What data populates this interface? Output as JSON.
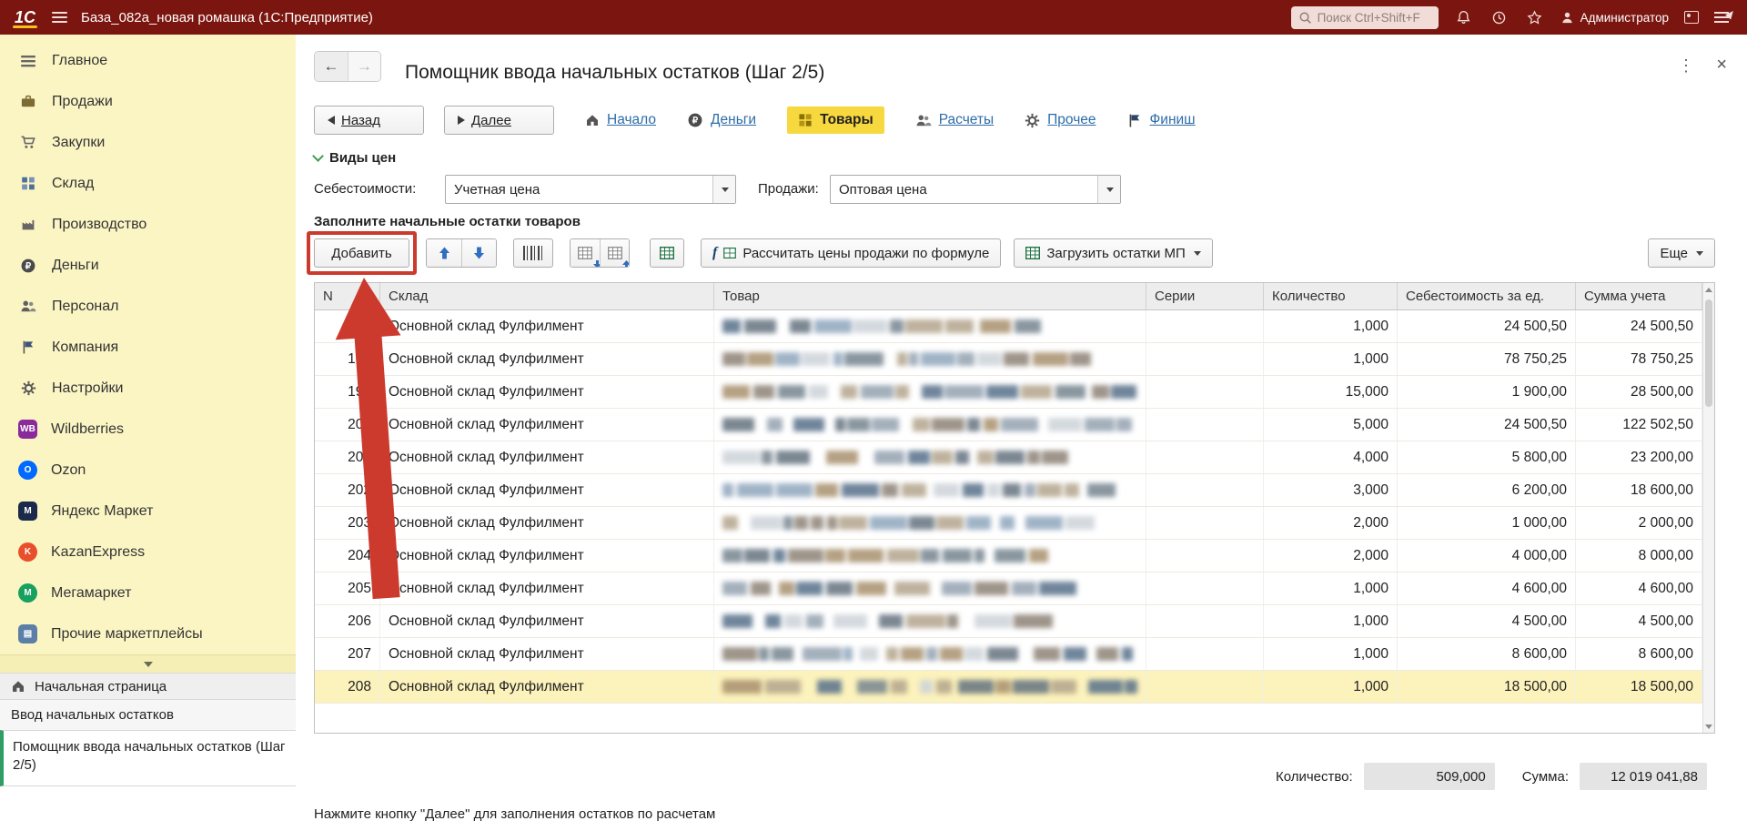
{
  "topbar": {
    "logo": "1С",
    "title": "База_082а_новая ромашка (1С:Предприятие)",
    "search_placeholder": "Поиск Ctrl+Shift+F",
    "user": "Администратор"
  },
  "colors": {
    "topbar_red": "#7B150F",
    "sidebar_yellow": "#FBF5C4",
    "active_step_yellow": "#F7D93F",
    "selected_row_yellow": "#FCF2BC",
    "link_blue": "#2D6DA8",
    "annotation_red": "#CC3A2D",
    "active_tab_marker_green": "#2E9E62"
  },
  "sidebar": {
    "items": [
      {
        "id": "main",
        "label": "Главное",
        "icon": "sections-icon"
      },
      {
        "id": "sales",
        "label": "Продажи",
        "icon": "briefcase-icon"
      },
      {
        "id": "purchases",
        "label": "Закупки",
        "icon": "cart-icon"
      },
      {
        "id": "warehouse",
        "label": "Склад",
        "icon": "warehouse-icon"
      },
      {
        "id": "production",
        "label": "Производство",
        "icon": "factory-icon"
      },
      {
        "id": "money",
        "label": "Деньги",
        "icon": "ruble-icon"
      },
      {
        "id": "staff",
        "label": "Персонал",
        "icon": "people-icon"
      },
      {
        "id": "company",
        "label": "Компания",
        "icon": "flag-icon"
      },
      {
        "id": "settings",
        "label": "Настройки",
        "icon": "gear-icon"
      },
      {
        "id": "wildberries",
        "label": "Wildberries",
        "icon": "wildberries-icon",
        "badge": "WB",
        "color": "#8A2A9B"
      },
      {
        "id": "ozon",
        "label": "Ozon",
        "icon": "ozon-icon",
        "badge": "O",
        "color": "#0069FF",
        "round": true
      },
      {
        "id": "yandex-market",
        "label": "Яндекс Маркет",
        "icon": "yandex-market-icon",
        "badge": "М",
        "color": "#1B2A4A"
      },
      {
        "id": "kazanexpress",
        "label": "KazanExpress",
        "icon": "kazanexpress-icon",
        "badge": "K",
        "color": "#E8502B",
        "round": true
      },
      {
        "id": "megamarket",
        "label": "Мегамаркет",
        "icon": "megamarket-icon",
        "badge": "М",
        "color": "#18A05E",
        "round": true
      },
      {
        "id": "other-marketplaces",
        "label": "Прочие маркетплейсы",
        "icon": "storefront-icon",
        "badge": "▤",
        "color": "#5B7FA6"
      }
    ],
    "footer_tabs": [
      "Начальная страница",
      "Ввод начальных остатков",
      "Помощник ввода начальных остатков (Шаг 2/5)"
    ]
  },
  "wizard": {
    "title": "Помощник ввода начальных остатков (Шаг 2/5)",
    "back": "Назад",
    "next": "Далее",
    "steps": [
      {
        "id": "nachalo",
        "label": "Начало",
        "icon": "home-icon",
        "active": false
      },
      {
        "id": "dengi",
        "label": "Деньги",
        "icon": "ruble-icon",
        "active": false
      },
      {
        "id": "tovary",
        "label": "Товары",
        "icon": "goods-icon",
        "active": true
      },
      {
        "id": "raschety",
        "label": "Расчеты",
        "icon": "people-icon",
        "active": false
      },
      {
        "id": "prochee",
        "label": "Прочее",
        "icon": "gear-icon",
        "active": false
      },
      {
        "id": "finish",
        "label": "Финиш",
        "icon": "finish-flag-icon",
        "active": false
      }
    ],
    "price_types": {
      "section_label": "Виды цен",
      "cost_label": "Себестоимости:",
      "cost_value": "Учетная цена",
      "sale_label": "Продажи:",
      "sale_value": "Оптовая цена"
    },
    "fill_caption": "Заполните начальные остатки товаров",
    "toolbar": {
      "add": "Добавить",
      "calc_prices": "Рассчитать цены продажи по формуле",
      "load_mp": "Загрузить остатки МП",
      "more": "Еще"
    },
    "hint": "Нажмите кнопку \"Далее\" для заполнения остатков по расчетам"
  },
  "table": {
    "columns": [
      "N",
      "Склад",
      "Товар",
      "Серии",
      "Количество",
      "Себестоимость за ед.",
      "Сумма учета"
    ],
    "rows": [
      {
        "n": "197",
        "warehouse": "Основной склад Фулфилмент",
        "quantity": "1,000",
        "unit_cost": "24 500,50",
        "total": "24 500,50"
      },
      {
        "n": "198",
        "warehouse": "Основной склад Фулфилмент",
        "quantity": "1,000",
        "unit_cost": "78 750,25",
        "total": "78 750,25"
      },
      {
        "n": "199",
        "warehouse": "Основной склад Фулфилмент",
        "quantity": "15,000",
        "unit_cost": "1 900,00",
        "total": "28 500,00"
      },
      {
        "n": "200",
        "warehouse": "Основной склад Фулфилмент",
        "quantity": "5,000",
        "unit_cost": "24 500,50",
        "total": "122 502,50"
      },
      {
        "n": "201",
        "warehouse": "Основной склад Фулфилмент",
        "quantity": "4,000",
        "unit_cost": "5 800,00",
        "total": "23 200,00"
      },
      {
        "n": "202",
        "warehouse": "Основной склад Фулфилмент",
        "quantity": "3,000",
        "unit_cost": "6 200,00",
        "total": "18 600,00"
      },
      {
        "n": "203",
        "warehouse": "Основной склад Фулфилмент",
        "quantity": "2,000",
        "unit_cost": "1 000,00",
        "total": "2 000,00"
      },
      {
        "n": "204",
        "warehouse": "Основной склад Фулфилмент",
        "quantity": "2,000",
        "unit_cost": "4 000,00",
        "total": "8 000,00"
      },
      {
        "n": "205",
        "warehouse": "Основной склад Фулфилмент",
        "quantity": "1,000",
        "unit_cost": "4 600,00",
        "total": "4 600,00"
      },
      {
        "n": "206",
        "warehouse": "Основной склад Фулфилмент",
        "quantity": "1,000",
        "unit_cost": "4 500,00",
        "total": "4 500,00"
      },
      {
        "n": "207",
        "warehouse": "Основной склад Фулфилмент",
        "quantity": "1,000",
        "unit_cost": "8 600,00",
        "total": "8 600,00"
      },
      {
        "n": "208",
        "warehouse": "Основной склад Фулфилмент",
        "quantity": "1,000",
        "unit_cost": "18 500,00",
        "total": "18 500,00",
        "selected": true
      }
    ],
    "totals": {
      "quantity_label": "Количество:",
      "quantity": "509,000",
      "sum_label": "Сумма:",
      "sum": "12 019 041,88"
    }
  },
  "annotation": {
    "type": "red-box-and-up-arrow",
    "highlights": "Добавить",
    "color": "#CC3A2D"
  }
}
